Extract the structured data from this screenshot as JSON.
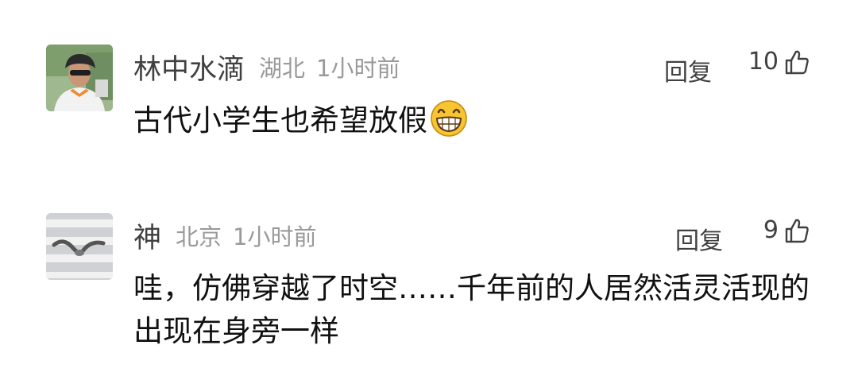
{
  "comments": [
    {
      "username": "林中水滴",
      "location": "湖北",
      "time": "1小时前",
      "reply_label": "回复",
      "likes": "10",
      "text": "古代小学生也希望放假",
      "emoji": "grinning-face-icon"
    },
    {
      "username": "神",
      "location": "北京",
      "time": "1小时前",
      "reply_label": "回复",
      "likes": "9",
      "text": "哇，仿佛穿越了时空……千年前的人居然活灵活现的出现在身旁一样"
    }
  ]
}
